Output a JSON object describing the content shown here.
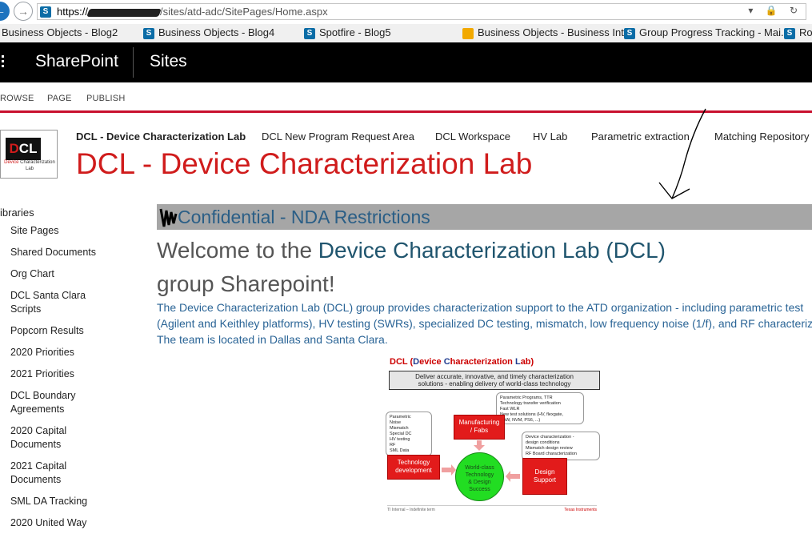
{
  "browser": {
    "url_prefix": "https://",
    "url_path": "/sites/atd-adc/SitePages/Home.aspx",
    "controls": "▾ 🔒 ↻"
  },
  "favorites": [
    {
      "label": "Business Objects - Blog2",
      "icon": "none"
    },
    {
      "label": "Business Objects - Blog4",
      "icon": "sharepoint-icon"
    },
    {
      "label": "Spotfire - Blog5",
      "icon": "sharepoint-icon"
    },
    {
      "label": "Business Objects - Business Int...",
      "icon": "business-objects-icon"
    },
    {
      "label": "Group Progress Tracking - Mai...",
      "icon": "sharepoint-icon"
    },
    {
      "label": "Ro",
      "icon": "sharepoint-icon"
    }
  ],
  "suite": {
    "brand": "SharePoint",
    "sites": "Sites"
  },
  "ribbon": {
    "tabs": [
      "ROWSE",
      "PAGE",
      "PUBLISH"
    ]
  },
  "logo": {
    "mark_d": "D",
    "mark_rest": "CL",
    "sub_red": "Device",
    "sub_rest": " Characterization Lab"
  },
  "topnav": [
    "DCL - Device Characterization Lab",
    "DCL New Program Request Area",
    "DCL Workspace",
    "HV Lab",
    "Parametric extraction",
    "Matching Repository"
  ],
  "site_title": "DCL - Device Characterization Lab",
  "leftnav": {
    "heading": "ibraries",
    "items": [
      "Site Pages",
      "Shared Documents",
      "Org Chart",
      "DCL Santa Clara Scripts",
      "Popcorn Results",
      "2020 Priorities",
      "2021 Priorities",
      "DCL Boundary Agreements",
      "2020 Capital Documents",
      "2021 Capital Documents",
      "SML DA Tracking",
      "2020 United Way"
    ]
  },
  "content": {
    "banner": "Confidential - NDA Restrictions",
    "welcome_prefix": "Welcome to the ",
    "welcome_highlight": "Device Characterization Lab (DCL)",
    "welcome_suffix": "group Sharepoint!",
    "desc_line1": "The Device Characterization Lab (DCL) group provides characterization support to the ATD organization - including parametric test",
    "desc_line2": "(Agilent and Keithley platforms), HV testing (SWRs), specialized DC testing, mismatch, low frequency noise (1/f), and RF characterization",
    "desc_line3": "The team is located in Dallas and Santa Clara."
  },
  "diagram": {
    "title_a": "DCL (",
    "title_d": "D",
    "title_b": "evice ",
    "title_c": "C",
    "title_e": "haracterization ",
    "title_l": "L",
    "title_f": "ab)",
    "mission_line1": "Deliver accurate, innovative, and timely characterization",
    "mission_line2": "solutions - enabling delivery of world-class technology",
    "left_notes": [
      "Parametric",
      "Noise",
      "Mismatch",
      "Special DC",
      "HV testing",
      "RF",
      "SML Data"
    ],
    "top_notes": [
      "Parametric Programs, TTR",
      "Technology transfer verification",
      "Fast WLR",
      "New test solutions (HV, flexgate,",
      "BAW, NVM, PS6, ...)"
    ],
    "right_notes": [
      "Device characterization -",
      "design conditions",
      "Mismatch design review",
      "RF Board characterization"
    ],
    "box_mfg_1": "Manufacturing",
    "box_mfg_2": "/ Fabs",
    "box_tech_1": "Technology",
    "box_tech_2": "development",
    "box_design_1": "Design",
    "box_design_2": "Support",
    "circle_1": "World-class",
    "circle_2": "Technology",
    "circle_3": "& Design",
    "circle_4": "Success",
    "footer_left": "TI Internal – Indefinite term",
    "footer_right": "Texas Instruments"
  }
}
